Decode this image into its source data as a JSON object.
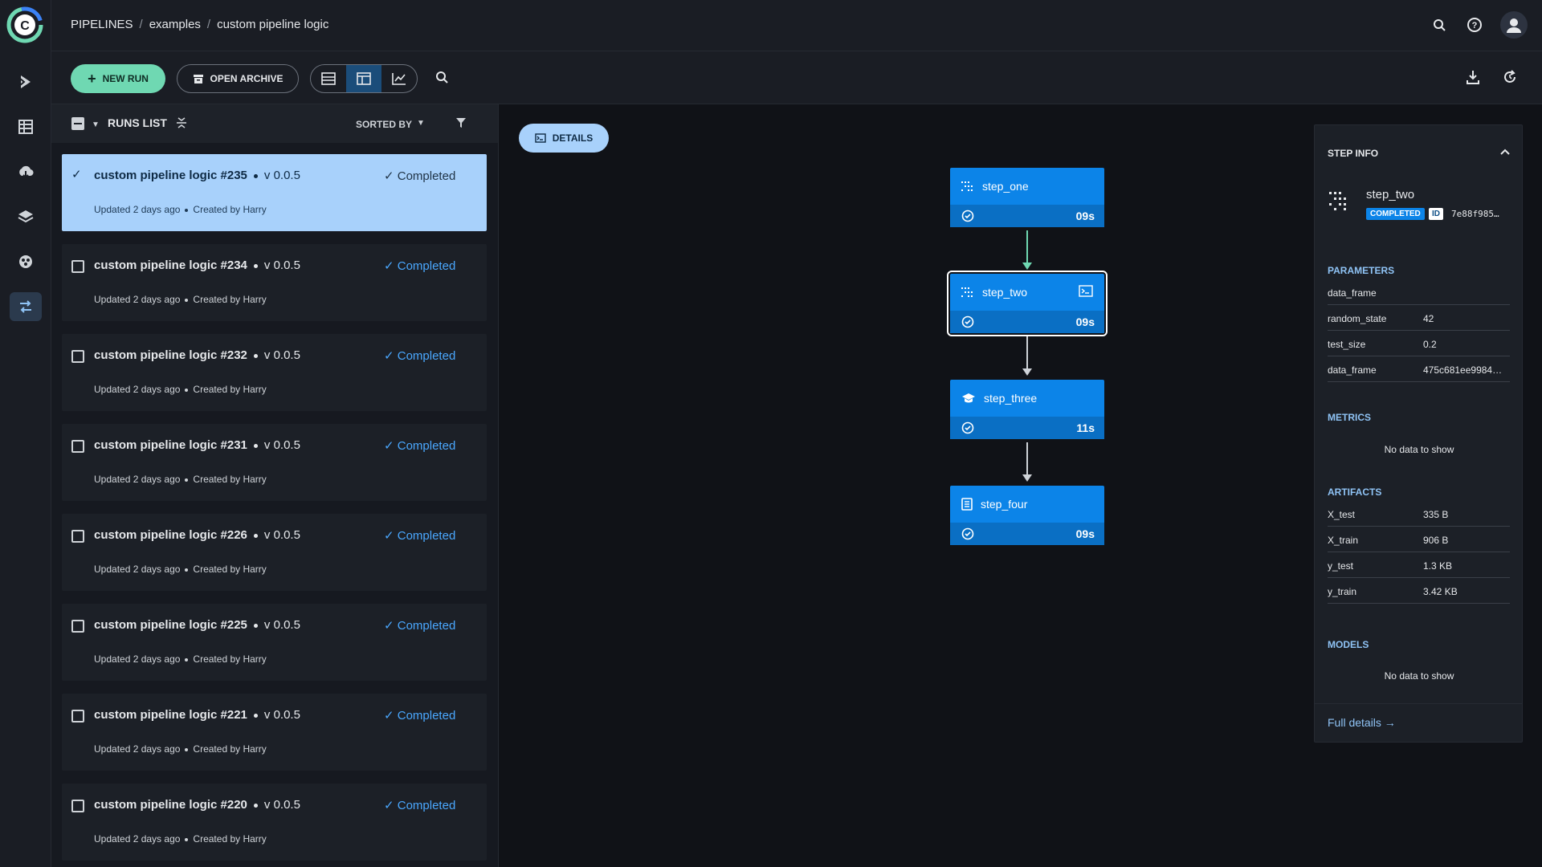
{
  "breadcrumb": {
    "root": "PIPELINES",
    "parent": "examples",
    "current": "custom pipeline logic"
  },
  "toolbar": {
    "new_run": "NEW RUN",
    "open_archive": "OPEN ARCHIVE"
  },
  "runs_list": {
    "title": "RUNS LIST",
    "sorted_by": "SORTED BY",
    "runs": [
      {
        "name": "custom pipeline logic #235",
        "version": "v 0.0.5",
        "status": "Completed",
        "updated": "Updated 2 days ago",
        "created_by": "Created by Harry",
        "selected": true
      },
      {
        "name": "custom pipeline logic #234",
        "version": "v 0.0.5",
        "status": "Completed",
        "updated": "Updated 2 days ago",
        "created_by": "Created by Harry",
        "selected": false
      },
      {
        "name": "custom pipeline logic #232",
        "version": "v 0.0.5",
        "status": "Completed",
        "updated": "Updated 2 days ago",
        "created_by": "Created by Harry",
        "selected": false
      },
      {
        "name": "custom pipeline logic #231",
        "version": "v 0.0.5",
        "status": "Completed",
        "updated": "Updated 2 days ago",
        "created_by": "Created by Harry",
        "selected": false
      },
      {
        "name": "custom pipeline logic #226",
        "version": "v 0.0.5",
        "status": "Completed",
        "updated": "Updated 2 days ago",
        "created_by": "Created by Harry",
        "selected": false
      },
      {
        "name": "custom pipeline logic #225",
        "version": "v 0.0.5",
        "status": "Completed",
        "updated": "Updated 2 days ago",
        "created_by": "Created by Harry",
        "selected": false
      },
      {
        "name": "custom pipeline logic #221",
        "version": "v 0.0.5",
        "status": "Completed",
        "updated": "Updated 2 days ago",
        "created_by": "Created by Harry",
        "selected": false
      },
      {
        "name": "custom pipeline logic #220",
        "version": "v 0.0.5",
        "status": "Completed",
        "updated": "Updated 2 days ago",
        "created_by": "Created by Harry",
        "selected": false
      }
    ]
  },
  "dag": {
    "details_button": "DETAILS",
    "nodes": [
      {
        "name": "step_one",
        "duration": "09s",
        "icon": "list-icon"
      },
      {
        "name": "step_two",
        "duration": "09s",
        "icon": "list-icon",
        "selected": true
      },
      {
        "name": "step_three",
        "duration": "11s",
        "icon": "graduation-cap-icon"
      },
      {
        "name": "step_four",
        "duration": "09s",
        "icon": "document-icon"
      }
    ]
  },
  "step_info": {
    "title": "STEP INFO",
    "step_name": "step_two",
    "status_badge": "COMPLETED",
    "id_label": "ID",
    "id_value": "7e88f985…",
    "parameters_title": "PARAMETERS",
    "parameters": [
      {
        "key": "data_frame",
        "value": ""
      },
      {
        "key": "random_state",
        "value": "42"
      },
      {
        "key": "test_size",
        "value": "0.2"
      },
      {
        "key": "data_frame",
        "value": "475c681ee9984…"
      }
    ],
    "metrics_title": "METRICS",
    "metrics_empty": "No data to show",
    "artifacts_title": "ARTIFACTS",
    "artifacts": [
      {
        "key": "X_test",
        "value": "335 B"
      },
      {
        "key": "X_train",
        "value": "906 B"
      },
      {
        "key": "y_test",
        "value": "1.3 KB"
      },
      {
        "key": "y_train",
        "value": "3.42 KB"
      }
    ],
    "models_title": "MODELS",
    "models_empty": "No data to show",
    "full_details": "Full details →"
  },
  "colors": {
    "accent_green": "#6fd8b2",
    "node_blue": "#0c84e8",
    "selected_run": "#a8d1fb",
    "status_blue": "#4aa8ff"
  }
}
